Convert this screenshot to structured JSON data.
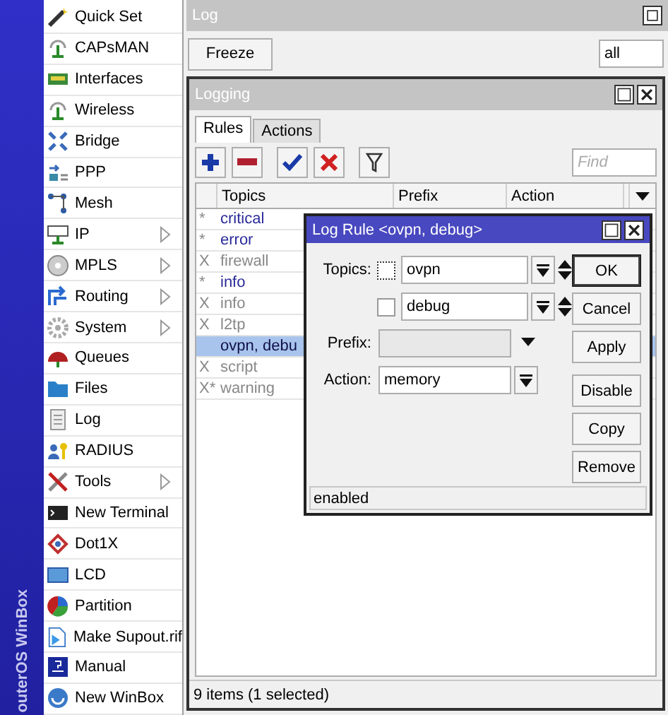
{
  "brand": {
    "text": "outerOS WinBox"
  },
  "sidebar": {
    "items": [
      {
        "label": "Quick Set",
        "submenu": false
      },
      {
        "label": "CAPsMAN",
        "submenu": false
      },
      {
        "label": "Interfaces",
        "submenu": false
      },
      {
        "label": "Wireless",
        "submenu": false
      },
      {
        "label": "Bridge",
        "submenu": false
      },
      {
        "label": "PPP",
        "submenu": false
      },
      {
        "label": "Mesh",
        "submenu": false
      },
      {
        "label": "IP",
        "submenu": true
      },
      {
        "label": "MPLS",
        "submenu": true
      },
      {
        "label": "Routing",
        "submenu": true
      },
      {
        "label": "System",
        "submenu": true
      },
      {
        "label": "Queues",
        "submenu": false
      },
      {
        "label": "Files",
        "submenu": false
      },
      {
        "label": "Log",
        "submenu": false
      },
      {
        "label": "RADIUS",
        "submenu": false
      },
      {
        "label": "Tools",
        "submenu": true
      },
      {
        "label": "New Terminal",
        "submenu": false
      },
      {
        "label": "Dot1X",
        "submenu": false
      },
      {
        "label": "LCD",
        "submenu": false
      },
      {
        "label": "Partition",
        "submenu": false
      },
      {
        "label": "Make Supout.rif",
        "submenu": false
      },
      {
        "label": "Manual",
        "submenu": false
      },
      {
        "label": "New WinBox",
        "submenu": false
      }
    ]
  },
  "log_window": {
    "title": "Log",
    "freeze_button": "Freeze",
    "filter_value": "all"
  },
  "logging_window": {
    "title": "Logging",
    "tabs": [
      {
        "label": "Rules",
        "selected": true
      },
      {
        "label": "Actions",
        "selected": false
      }
    ],
    "find": {
      "placeholder": "Find"
    },
    "table": {
      "columns": [
        "Topics",
        "Prefix",
        "Action"
      ],
      "rows": [
        {
          "flag": "*",
          "topics": "critical",
          "disabled": false,
          "selected": false
        },
        {
          "flag": "*",
          "topics": "error",
          "disabled": false,
          "selected": false
        },
        {
          "flag": "X",
          "topics": "firewall",
          "disabled": true,
          "selected": false
        },
        {
          "flag": "*",
          "topics": "info",
          "disabled": false,
          "selected": false
        },
        {
          "flag": "X",
          "topics": "info",
          "disabled": true,
          "selected": false
        },
        {
          "flag": "X",
          "topics": "l2tp",
          "disabled": true,
          "selected": false
        },
        {
          "flag": "",
          "topics": "ovpn, debu",
          "disabled": false,
          "selected": true
        },
        {
          "flag": "X",
          "topics": "script",
          "disabled": true,
          "selected": false
        },
        {
          "flag": "X*",
          "topics": "warning",
          "disabled": true,
          "selected": false
        }
      ]
    },
    "status": "9 items (1 selected)"
  },
  "dialog": {
    "title": "Log Rule <ovpn, debug>",
    "topics_label": "Topics:",
    "topics": [
      {
        "value": "ovpn",
        "checked": false
      },
      {
        "value": "debug",
        "checked": false
      }
    ],
    "prefix_label": "Prefix:",
    "action_label": "Action:",
    "action_value": "memory",
    "buttons": [
      {
        "label": "OK",
        "default": true
      },
      {
        "label": "Cancel",
        "default": false
      },
      {
        "label": "Apply",
        "default": false
      },
      {
        "label": "Disable",
        "default": false
      },
      {
        "label": "Copy",
        "default": false
      },
      {
        "label": "Remove",
        "default": false
      }
    ],
    "status": "enabled"
  }
}
